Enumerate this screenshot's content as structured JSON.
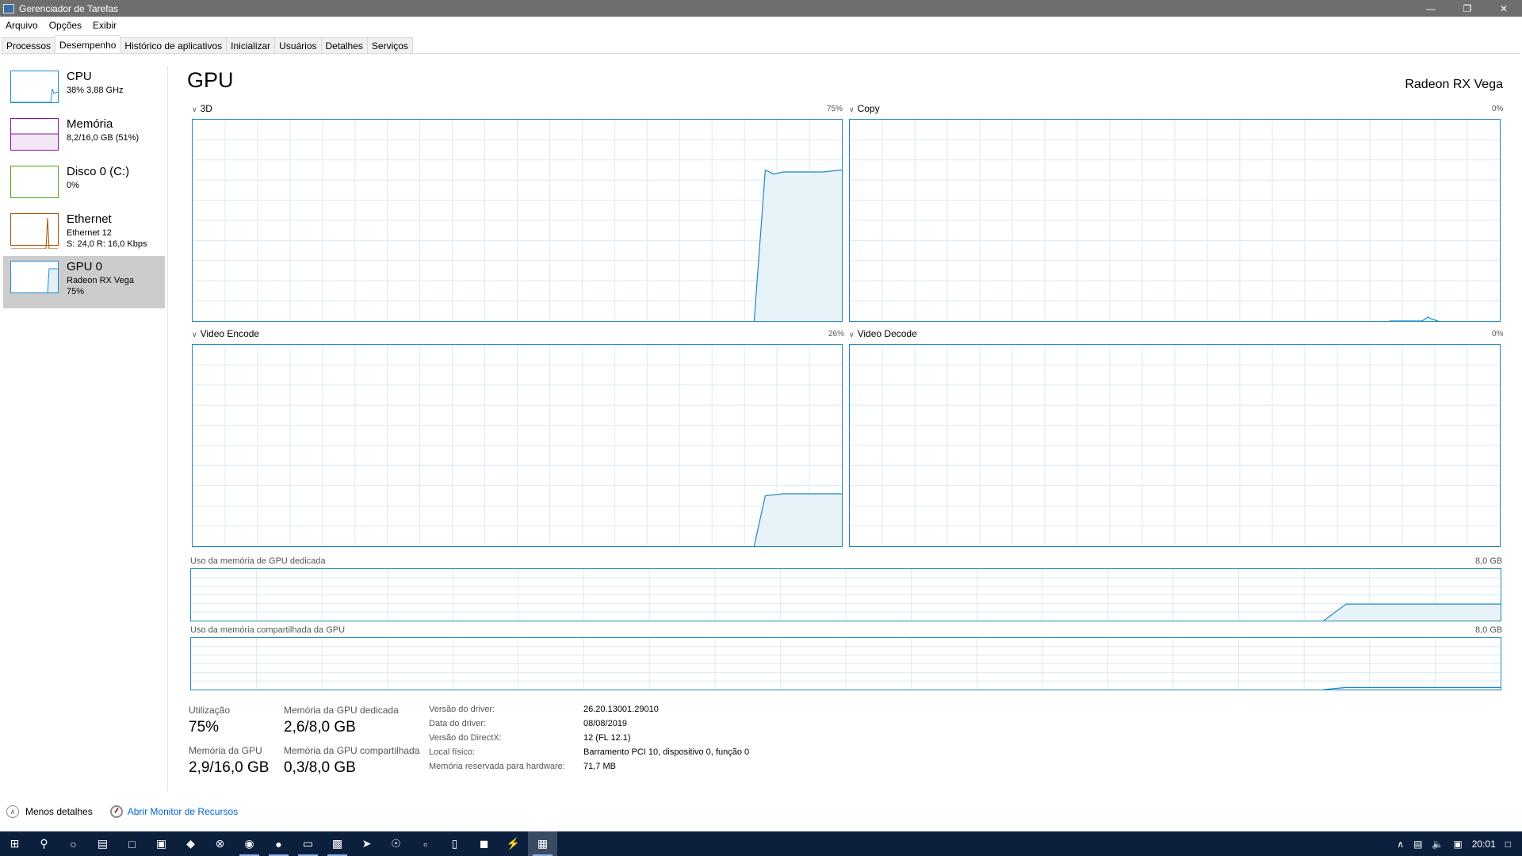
{
  "window": {
    "title": "Gerenciador de Tarefas"
  },
  "menu": [
    "Arquivo",
    "Opções",
    "Exibir"
  ],
  "tabs": [
    "Processos",
    "Desempenho",
    "Histórico de aplicativos",
    "Inicializar",
    "Usuários",
    "Detalhes",
    "Serviços"
  ],
  "sidebar": [
    {
      "title": "CPU",
      "sub1": "38% 3,88 GHz",
      "sub2": "",
      "color": "#1b8fd1"
    },
    {
      "title": "Memória",
      "sub1": "8,2/16,0 GB (51%)",
      "sub2": "",
      "color": "#8b12ae"
    },
    {
      "title": "Disco 0 (C:)",
      "sub1": "0%",
      "sub2": "",
      "color": "#4da60c"
    },
    {
      "title": "Ethernet",
      "sub1": "Ethernet 12",
      "sub2": "S: 24,0 R: 16,0 Kbps",
      "color": "#a74f01"
    },
    {
      "title": "GPU 0",
      "sub1": "Radeon RX Vega",
      "sub2": "75%",
      "color": "#1b8fd1"
    }
  ],
  "main": {
    "title": "GPU",
    "device": "Radeon RX Vega",
    "graphs": [
      {
        "label": "3D",
        "pct": "75%"
      },
      {
        "label": "Copy",
        "pct": "0%"
      },
      {
        "label": "Video Encode",
        "pct": "26%"
      },
      {
        "label": "Video Decode",
        "pct": "0%"
      }
    ],
    "dedicated_label": "Uso da memória de GPU dedicada",
    "dedicated_max": "8,0 GB",
    "shared_label": "Uso da memória compartilhada da GPU",
    "shared_max": "8,0 GB"
  },
  "stats": {
    "util_label": "Utilização",
    "util_value": "75%",
    "ded_label": "Memória da GPU dedicada",
    "ded_value": "2,6/8,0 GB",
    "gpu_mem_label": "Memória da GPU",
    "gpu_mem_value": "2,9/16,0 GB",
    "shared_label": "Memória da GPU compartilhada",
    "shared_value": "0,3/8,0 GB"
  },
  "info": [
    {
      "label": "Versão do driver:",
      "value": "26.20.13001.29010"
    },
    {
      "label": "Data do driver:",
      "value": "08/08/2019"
    },
    {
      "label": "Versão do DirectX:",
      "value": "12 (FL 12.1)"
    },
    {
      "label": "Local físico:",
      "value": "Barramento PCI 10, dispositivo 0, função 0"
    },
    {
      "label": "Memória reservada para hardware:",
      "value": "71,7 MB"
    }
  ],
  "footer": {
    "less": "Menos detalhes",
    "monitor": "Abrir Monitor de Recursos"
  },
  "tray": {
    "time": "20:01"
  },
  "accent": "#1e87c0"
}
